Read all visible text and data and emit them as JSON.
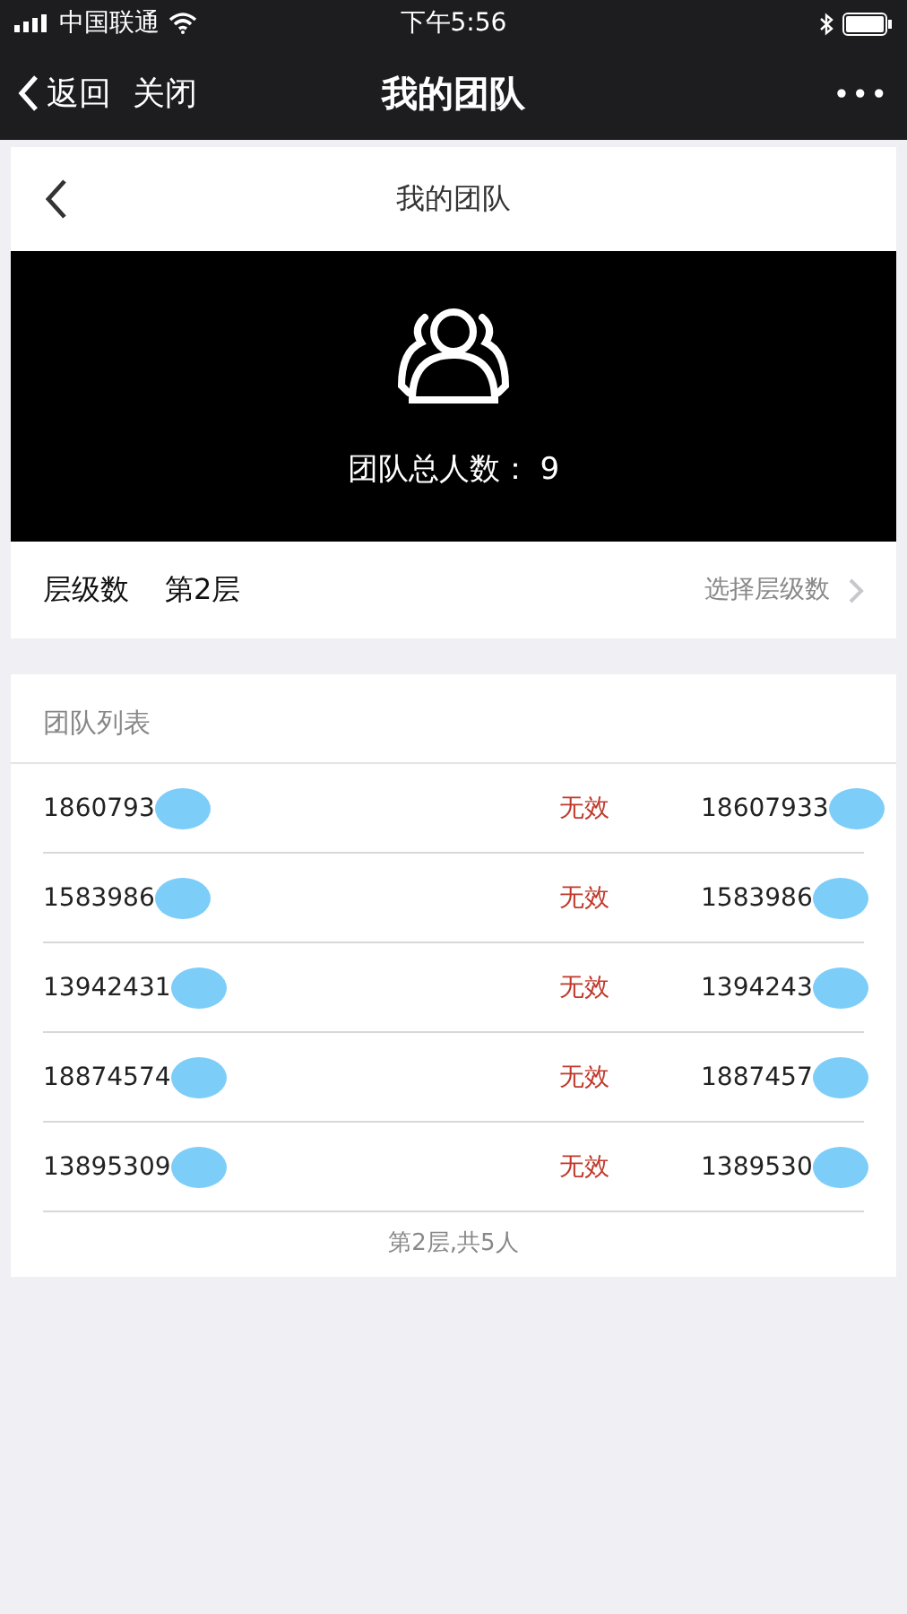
{
  "status_bar": {
    "carrier": "中国联通",
    "time": "下午5:56"
  },
  "nav_bar": {
    "back": "返回",
    "close": "关闭",
    "title": "我的团队",
    "more": "•••"
  },
  "page_header": {
    "title": "我的团队"
  },
  "banner": {
    "total_label": "团队总人数：",
    "total": "9"
  },
  "level_row": {
    "label": "层级数",
    "value": "第2层",
    "action": "选择层级数"
  },
  "team_list": {
    "title": "团队列表",
    "rows": [
      {
        "phone": "1860793",
        "status": "无效",
        "referrer": "18607933"
      },
      {
        "phone": "1583986",
        "status": "无效",
        "referrer": "1583986"
      },
      {
        "phone": "13942431",
        "status": "无效",
        "referrer": "1394243"
      },
      {
        "phone": "18874574",
        "status": "无效",
        "referrer": "1887457"
      },
      {
        "phone": "13895309",
        "status": "无效",
        "referrer": "1389530"
      }
    ],
    "footer": "第2层,共5人"
  }
}
